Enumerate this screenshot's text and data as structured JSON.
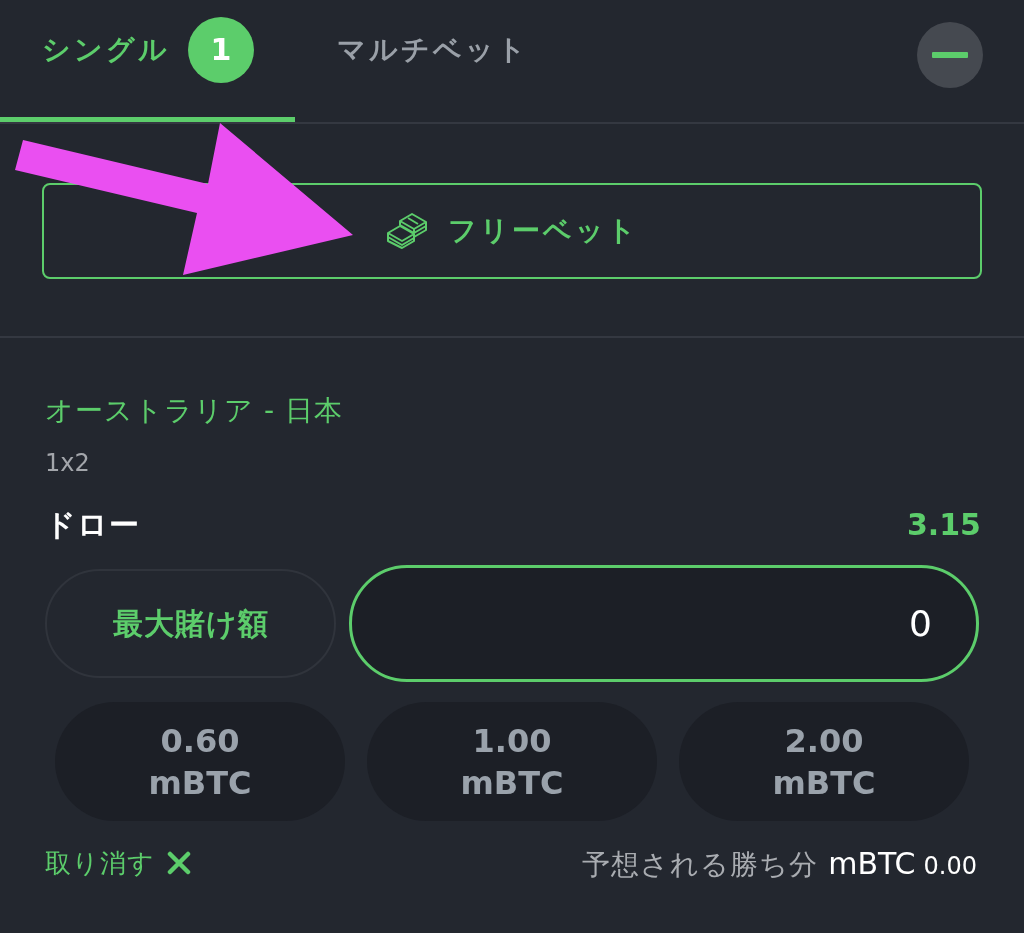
{
  "tabs": [
    {
      "label": "シングル",
      "badge": "1",
      "selected": true
    },
    {
      "label": "マルチベット",
      "selected": false
    }
  ],
  "free_bet_button": {
    "label": "フリーベット"
  },
  "bet": {
    "event": "オーストラリア - 日本",
    "market": "1x2",
    "selection": "ドロー",
    "odds": "3.15",
    "max_stake_button": "最大賭け額",
    "stake_input": {
      "value": "0"
    },
    "quick_stakes": [
      {
        "amount": "0.60",
        "unit": "mBTC"
      },
      {
        "amount": "1.00",
        "unit": "mBTC"
      },
      {
        "amount": "2.00",
        "unit": "mBTC"
      }
    ],
    "cancel_button": "取り消す",
    "potential_win": {
      "label": "予想される勝ち分",
      "currency": "mBTC",
      "value": "0.00"
    }
  },
  "annotations": [
    {
      "kind": "arrow"
    }
  ]
}
